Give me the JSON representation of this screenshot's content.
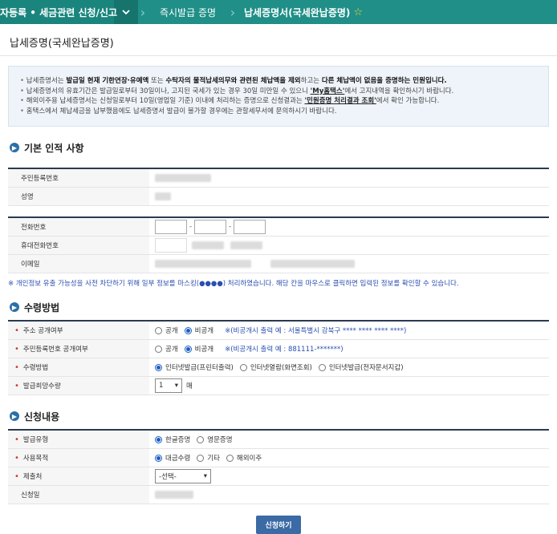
{
  "topbar": {
    "menu1": "자등록 • 세금관련 신청/신고",
    "menu2": "즉시발급 증명",
    "menu3": "납세증명서(국세완납증명)",
    "star": "☆"
  },
  "page_title": "납세증명(국세완납증명)",
  "notice": {
    "l1_a": "납세증명서는 ",
    "l1_b": "발급일 현재 기한연장·유예액",
    "l1_c": " 또는 ",
    "l1_d": "수탁자의 물적납세의무와 관련된 체납액을 제외",
    "l1_e": "하고는 ",
    "l1_f": "다른 체납액이 없음을 증명하는 민원입니다.",
    "l2_a": "납세증명서의 유효기간은 발급일로부터 30일이나, 고지된 국세가 있는 경우 30일 미만일 수 있으니 ",
    "l2_b": "'My홈택스'",
    "l2_c": "에서 고지내역을 확인하시기 바랍니다.",
    "l3_a": "해외이주용 납세증명서는 신청일로부터 10일(영업일 기준) 이내에 처리하는 증명으로 신청결과는 ",
    "l3_b": "'민원증명 처리결과 조회'",
    "l3_c": "에서 확인 가능합니다.",
    "l4": "홈택스에서 체납세금을 납부했음에도 납세증명서 발급이 불가할 경우에는 관할세무서에 문의하시기 바랍니다."
  },
  "section1": {
    "title": "기본 인적 사항",
    "resident_no_label": "주민등록번호",
    "name_label": "성명",
    "phone_label": "전화번호",
    "mobile_label": "휴대전화번호",
    "email_label": "이메일",
    "dash": "-"
  },
  "mask_note": "※ 개인정보 유출 가능성을 사전 차단하기 위해 일부 정보를 마스킹(●●●●) 처리하였습니다. 해당 칸을 마우스로 클릭하면 입력된 정보를 확인할 수 있습니다.",
  "section2": {
    "title": "수령방법",
    "addr_label": "주소 공개여부",
    "addr_opt1": "공개",
    "addr_opt2": "비공개",
    "addr_hint": "※(비공개시 출력 예 : 서울특별시 강북구 **** **** **** ****)",
    "rrn_label": "주민등록번호 공개여부",
    "rrn_opt1": "공개",
    "rrn_opt2": "비공개",
    "rrn_hint": "※(비공개시 출력 예 : 881111-*******)",
    "method_label": "수령방법",
    "method_opt1": "인터넷발급(프린터출력)",
    "method_opt2": "인터넷열람(화면조회)",
    "method_opt3": "인터넷발급(전자문서지갑)",
    "qty_label": "발급희망수량",
    "qty_value": "1",
    "qty_unit": "매"
  },
  "section3": {
    "title": "신청내용",
    "type_label": "발급유형",
    "type_opt1": "한글증명",
    "type_opt2": "영문증명",
    "purpose_label": "사용목적",
    "purpose_opt1": "대금수령",
    "purpose_opt2": "기타",
    "purpose_opt3": "해외이주",
    "submit_to_label": "제출처",
    "submit_to_value": "-선택-",
    "date_label": "신청일"
  },
  "submit_button": "신청하기"
}
